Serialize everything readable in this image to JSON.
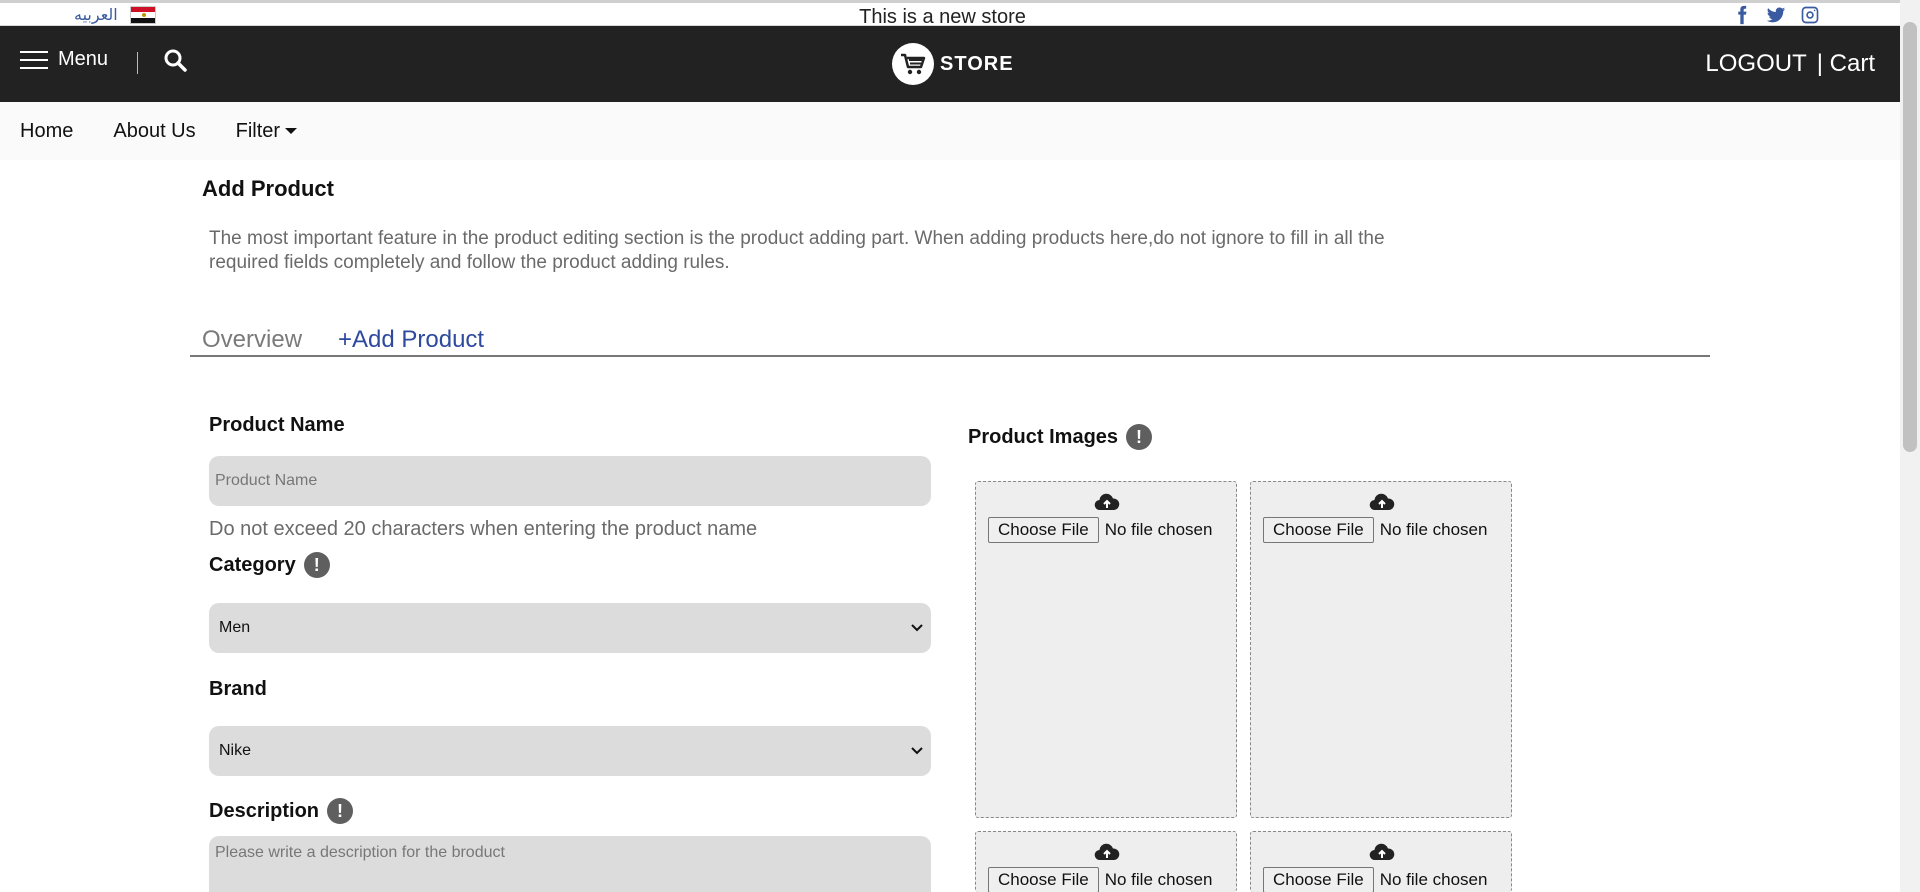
{
  "topstrip": {
    "language_label": "العربيه",
    "store_message": "This is a new store",
    "social_icons": [
      "facebook-icon",
      "twitter-icon",
      "instagram-icon"
    ]
  },
  "header": {
    "menu_label": "Menu",
    "logo_text": "STORE",
    "logout_label": "LOGOUT",
    "cart_label": "| Cart"
  },
  "nav": {
    "items": [
      {
        "label": "Home"
      },
      {
        "label": "About Us"
      },
      {
        "label": "Filter"
      }
    ]
  },
  "main": {
    "title": "Add Product",
    "description": "The most important feature in the product editing section is the product adding part. When adding products here,do not ignore to fill in all the required fields completely and follow the product adding rules.",
    "tabs": [
      {
        "label": "Overview"
      },
      {
        "label": "+Add Product"
      }
    ]
  },
  "form": {
    "product_name_label": "Product Name",
    "product_name_placeholder": "Product Name",
    "product_name_hint": "Do not exceed 20 characters when entering the product name",
    "category_label": "Category",
    "category_value": "Men",
    "brand_label": "Brand",
    "brand_value": "Nike",
    "description_label": "Description",
    "description_placeholder": "Please write a description for the broduct",
    "info_glyph": "!"
  },
  "images": {
    "label": "Product Images",
    "choose_file_label": "Choose File",
    "no_file_label": "No file chosen"
  },
  "colors": {
    "header_bg": "#222222",
    "accent_blue": "#2e4a9e",
    "input_bg": "#dcdcdc"
  }
}
